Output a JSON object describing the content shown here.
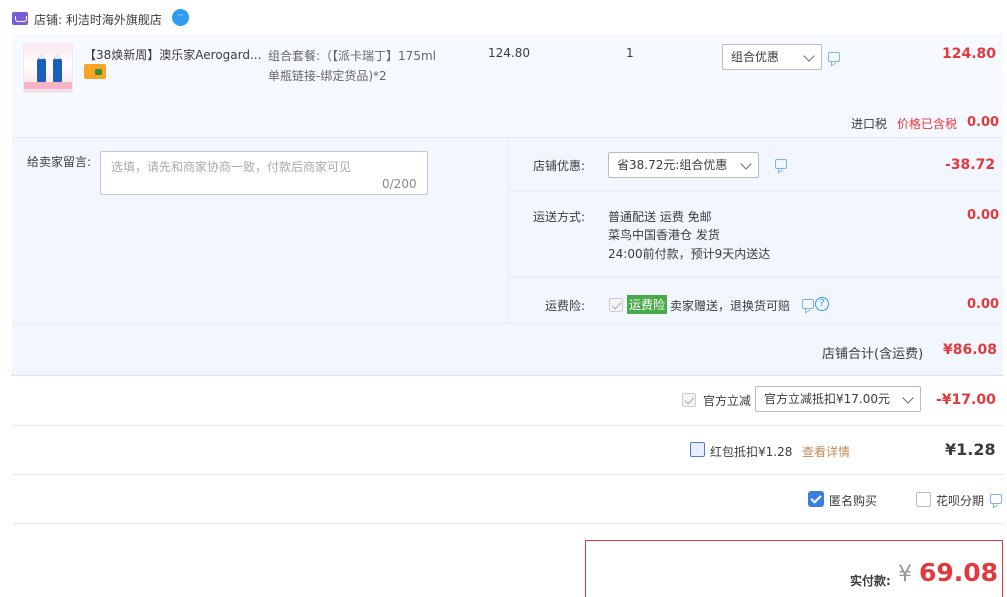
{
  "store": {
    "label": "店铺: 利洁时海外旗舰店"
  },
  "product": {
    "title": "【38焕新周】澳乐家Aerogard...",
    "sku_line1": "组合套餐:（【派卡瑞丁】175ml",
    "sku_line2": "单瓶链接-绑定货品)*2",
    "unit_price": "124.80",
    "quantity": "1",
    "bundle_option": "组合优惠",
    "line_total": "124.80"
  },
  "tax": {
    "label": "进口税",
    "note": "价格已含税",
    "value": "0.00"
  },
  "message": {
    "label": "给卖家留言:",
    "placeholder": "选填，请先和商家协商一致，付款后商家可见",
    "count": "0/200"
  },
  "store_discount": {
    "label": "店铺优惠:",
    "selected": "省38.72元:组合优惠",
    "value": "-38.72"
  },
  "shipping": {
    "label": "运送方式:",
    "line1": "普通配送 运费 免邮",
    "line2": "菜鸟中国香港仓  发货",
    "line3": "24:00前付款，预计9天内送达",
    "value": "0.00"
  },
  "insurance": {
    "label": "运费险:",
    "tag": "运费险",
    "text": "卖家赠送，退换货可赔",
    "help": "?",
    "value": "0.00"
  },
  "store_total": {
    "label": "店铺合计(含运费)",
    "value": "¥86.08"
  },
  "official_discount": {
    "label": "官方立减",
    "selected": "官方立减抵扣¥17.00元",
    "value": "-¥17.00"
  },
  "red_packet": {
    "label": "红包抵扣¥1.28",
    "detail_link": "查看详情",
    "value": "¥1.28"
  },
  "options": {
    "anonymous_label": "匿名购买",
    "huabei_label": "花呗分期"
  },
  "payment": {
    "label": "实付款:",
    "currency": "¥",
    "value": "69.08"
  }
}
